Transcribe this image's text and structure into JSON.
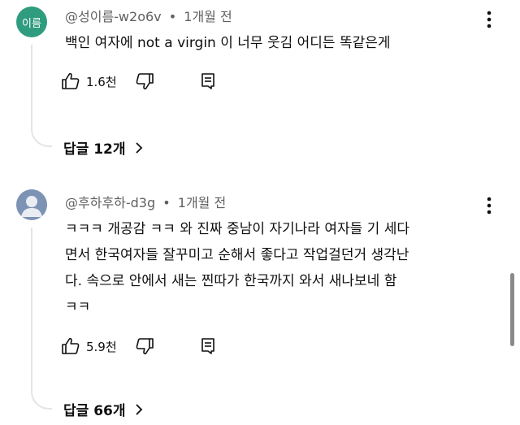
{
  "comments": [
    {
      "avatar_text": "이름",
      "handle": "@성이름-w2o6v",
      "time": "1개월 전",
      "lines": [
        "백인 여자에 not a virgin 이 너무 웃김 어디든 똑같은게"
      ],
      "likes": "1.6천",
      "replies_label": "답글 12개",
      "avatar_color": "#2f9c7f"
    },
    {
      "handle": "@후하후하-d3g",
      "time": "1개월 전",
      "lines": [
        "ㅋㅋㅋ 개공감 ㅋㅋ 와 진짜 중남이 자기나라 여자들 기 세다",
        "면서 한국여자들 잘꾸미고 순해서 좋다고 작업걸던거 생각난",
        "다. 속으로 안에서 새는 찐따가 한국까지 와서 새나보네 함",
        "ㅋㅋ"
      ],
      "likes": "5.9천",
      "replies_label": "답글 66개",
      "avatar_color": "#7d93b4"
    }
  ],
  "separator": "•",
  "icons": [
    "thumbs-up-icon",
    "thumbs-down-icon",
    "reply-icon",
    "more-vert-icon",
    "chevron-right-icon",
    "default-avatar-icon"
  ]
}
